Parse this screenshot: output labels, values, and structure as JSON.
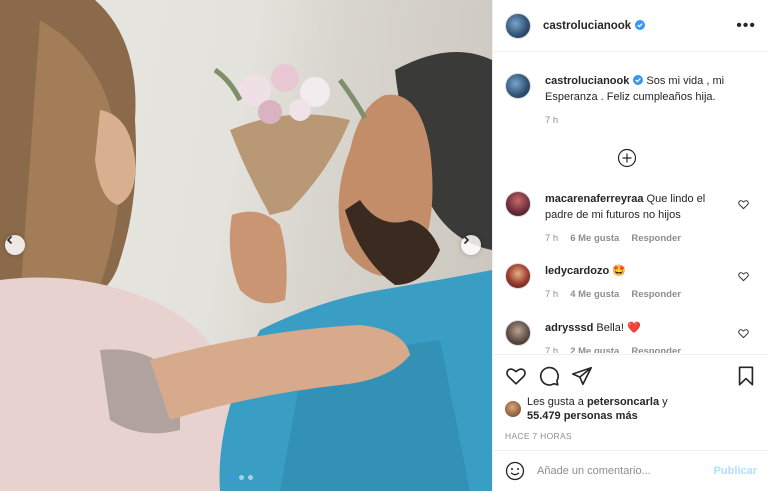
{
  "post": {
    "author": "castrolucianook",
    "more_icon": "more-horizontal-icon",
    "caption_text": "Sos mi vida , mi Esperanza . Feliz cumpleaños hija.",
    "caption_time": "7 h"
  },
  "comments": [
    {
      "username": "macarenaferreyraa",
      "text": "Que lindo el padre de mi futuros no hijos",
      "time": "7 h",
      "likes": "6 Me gusta",
      "reply": "Responder"
    },
    {
      "username": "ledycardozo",
      "text": "🤩",
      "time": "7 h",
      "likes": "4 Me gusta",
      "reply": "Responder"
    },
    {
      "username": "adrysssd",
      "text": "Bella! ❤️",
      "time": "7 h",
      "likes": "2 Me gusta",
      "reply": "Responder"
    }
  ],
  "likes": {
    "prefix": "Les gusta a",
    "first_user": "petersoncarla",
    "and": "y",
    "others": "55.479 personas más"
  },
  "post_time": "HACE 7 HORAS",
  "add_comment": {
    "placeholder": "Añade un comentario...",
    "publish_label": "Publicar"
  },
  "carousel": {
    "dots": 3,
    "active_index": 0
  },
  "colors": {
    "verified": "#3897f0",
    "publish": "#b2dffc",
    "heart_red": "#ed4956",
    "meta_gray": "#8e8e8e"
  }
}
